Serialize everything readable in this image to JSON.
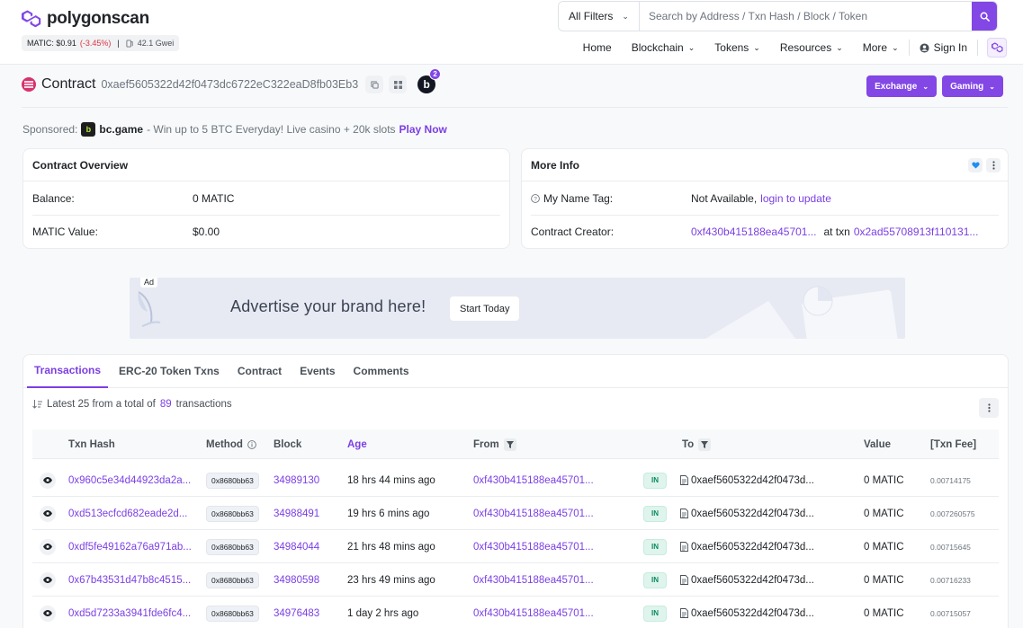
{
  "header": {
    "logo_text": "polygonscan",
    "price_label": "MATIC: $0.91",
    "price_change": "(-3.45%)",
    "price_sep": "|",
    "gas": "42.1 Gwei",
    "filter_label": "All Filters",
    "search_placeholder": "Search by Address / Txn Hash / Block / Token",
    "nav": {
      "home": "Home",
      "blockchain": "Blockchain",
      "tokens": "Tokens",
      "resources": "Resources",
      "more": "More",
      "signin": "Sign In"
    }
  },
  "contract": {
    "label": "Contract",
    "address": "0xaef5605322d42f0473dc6722eC322eaD8fb03Eb3",
    "badge_letter": "b",
    "badge_count": "2",
    "exchange_label": "Exchange",
    "gaming_label": "Gaming"
  },
  "sponsored": {
    "prefix": "Sponsored:",
    "brand_icon": "b",
    "brand": "bc.game",
    "text": "- Win up to 5 BTC Everyday! Live casino + 20k slots",
    "cta": "Play Now"
  },
  "overview": {
    "title": "Contract Overview",
    "balance_label": "Balance:",
    "balance_value": "0 MATIC",
    "value_label": "MATIC Value:",
    "value_value": "$0.00"
  },
  "more_info": {
    "title": "More Info",
    "name_tag_label": "My Name Tag:",
    "name_tag_value": "Not Available,",
    "name_tag_link": "login to update",
    "creator_label": "Contract Creator:",
    "creator_addr": "0xf430b415188ea45701...",
    "at_txn": "at txn",
    "creator_txn": "0x2ad55708913f110131..."
  },
  "ad": {
    "tag": "Ad",
    "text": "Advertise your brand here!",
    "button": "Start Today"
  },
  "tabs": [
    "Transactions",
    "ERC-20 Token Txns",
    "Contract",
    "Events",
    "Comments"
  ],
  "summary": {
    "prefix": "Latest 25 from a total of",
    "count": "89",
    "suffix": "transactions"
  },
  "columns": {
    "hash": "Txn Hash",
    "method": "Method",
    "block": "Block",
    "age": "Age",
    "from": "From",
    "to": "To",
    "value": "Value",
    "fee": "[Txn Fee]"
  },
  "rows": [
    {
      "hash": "0x960c5e34d44923da2a...",
      "method": "0x8680bb63",
      "block": "34989130",
      "age": "18 hrs 44 mins ago",
      "from": "0xf430b415188ea45701...",
      "dir": "IN",
      "to": "0xaef5605322d42f0473d...",
      "value": "0 MATIC",
      "fee": "0.00714175"
    },
    {
      "hash": "0xd513ecfcd682eade2d...",
      "method": "0x8680bb63",
      "block": "34988491",
      "age": "19 hrs 6 mins ago",
      "from": "0xf430b415188ea45701...",
      "dir": "IN",
      "to": "0xaef5605322d42f0473d...",
      "value": "0 MATIC",
      "fee": "0.007260575"
    },
    {
      "hash": "0xdf5fe49162a76a971ab...",
      "method": "0x8680bb63",
      "block": "34984044",
      "age": "21 hrs 48 mins ago",
      "from": "0xf430b415188ea45701...",
      "dir": "IN",
      "to": "0xaef5605322d42f0473d...",
      "value": "0 MATIC",
      "fee": "0.00715645"
    },
    {
      "hash": "0x67b43531d47b8c4515...",
      "method": "0x8680bb63",
      "block": "34980598",
      "age": "23 hrs 49 mins ago",
      "from": "0xf430b415188ea45701...",
      "dir": "IN",
      "to": "0xaef5605322d42f0473d...",
      "value": "0 MATIC",
      "fee": "0.00716233"
    },
    {
      "hash": "0xd5d7233a3941fde6fc4...",
      "method": "0x8680bb63",
      "block": "34976483",
      "age": "1 day 2 hrs ago",
      "from": "0xf430b415188ea45701...",
      "dir": "IN",
      "to": "0xaef5605322d42f0473d...",
      "value": "0 MATIC",
      "fee": "0.00715057"
    }
  ],
  "colors": {
    "brand": "#8247e5",
    "link": "#7b3fe4",
    "negative": "#dc3545",
    "in_badge": "#0b8a5f"
  }
}
